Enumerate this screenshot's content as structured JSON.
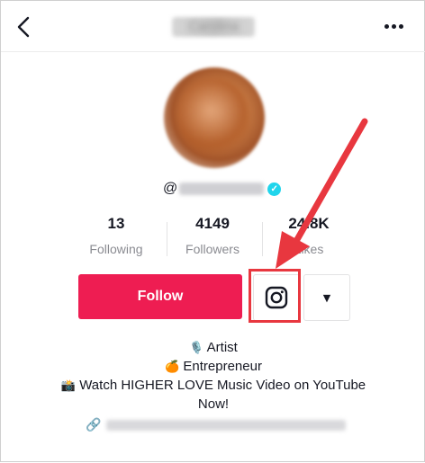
{
  "header": {
    "back_icon": "chevron-left-icon",
    "title": "Carolina",
    "more_icon": "more-horizontal-icon"
  },
  "profile": {
    "at_symbol": "@",
    "verified_icon": "verified-check-icon",
    "verified_glyph": "✓"
  },
  "stats": [
    {
      "value": "13",
      "label": "Following"
    },
    {
      "value": "4149",
      "label": "Followers"
    },
    {
      "value": "24.8K",
      "label": "Likes"
    }
  ],
  "actions": {
    "follow_label": "Follow",
    "instagram_icon": "instagram-icon",
    "dropdown_icon": "triangle-down-icon",
    "dropdown_glyph": "▼"
  },
  "bio": {
    "line1_emoji": "🎙️",
    "line1_text": "Artist",
    "line2_emoji": "🍊",
    "line2_text": "Entrepreneur",
    "line3_emoji": "📸",
    "line3_text": "Watch HIGHER LOVE Music Video on YouTube",
    "line4_text": "Now!"
  },
  "link": {
    "icon": "link-icon",
    "glyph": "🔗"
  },
  "colors": {
    "follow_button": "#ee1d52",
    "annotation_red": "#e8373f",
    "verified": "#20d5ec"
  }
}
